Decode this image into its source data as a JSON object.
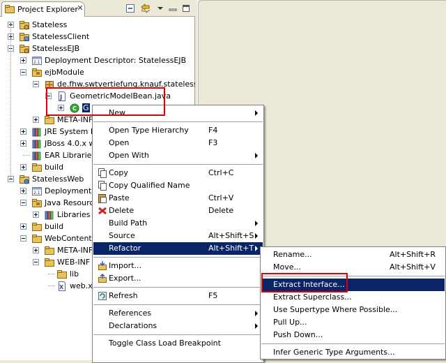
{
  "view": {
    "title": "Project Explorer",
    "close_glyph": "✕"
  },
  "tree": [
    {
      "label": "Stateless",
      "icon": "ejb-project-icon",
      "level": 0,
      "expander": "plus"
    },
    {
      "label": "StatelessClient",
      "icon": "client-project-icon",
      "level": 0,
      "expander": "plus"
    },
    {
      "label": "StatelessEJB",
      "icon": "ejb-project-icon",
      "level": 0,
      "expander": "minus"
    },
    {
      "label": "Deployment Descriptor: StatelessEJB",
      "icon": "deployment-descriptor-icon",
      "level": 1,
      "expander": "plus"
    },
    {
      "label": "ejbModule",
      "icon": "source-folder-icon",
      "level": 1,
      "expander": "minus"
    },
    {
      "label": "de.fhw.swtvertiefung.knauf.stateless",
      "icon": "package-icon",
      "level": 2,
      "expander": "minus"
    },
    {
      "label": "GeometricModelBean.java",
      "icon": "java-file-icon",
      "level": 3,
      "expander": "minus"
    },
    {
      "label": "G",
      "icon": "class-icon",
      "level": 4,
      "expander": "plus",
      "selected": true
    },
    {
      "label": "META-INF",
      "icon": "folder-icon",
      "level": 2,
      "expander": "plus"
    },
    {
      "label": "JRE System Li",
      "icon": "library-icon",
      "level": 1,
      "expander": "plus"
    },
    {
      "label": "JBoss 4.0.x w",
      "icon": "library-icon",
      "level": 1,
      "expander": "plus"
    },
    {
      "label": "EAR Libraries",
      "icon": "library-icon",
      "level": 1,
      "expander": "none"
    },
    {
      "label": "build",
      "icon": "folder-icon",
      "level": 1,
      "expander": "plus"
    },
    {
      "label": "StatelessWeb",
      "icon": "web-project-icon",
      "level": 0,
      "expander": "minus"
    },
    {
      "label": "Deployment D",
      "icon": "deployment-descriptor-icon",
      "level": 1,
      "expander": "plus"
    },
    {
      "label": "Java Resourc",
      "icon": "source-folder-icon",
      "level": 1,
      "expander": "minus"
    },
    {
      "label": "Libraries",
      "icon": "library-icon",
      "level": 2,
      "expander": "plus"
    },
    {
      "label": "build",
      "icon": "folder-icon",
      "level": 1,
      "expander": "plus"
    },
    {
      "label": "WebContent",
      "icon": "folder-icon",
      "level": 1,
      "expander": "minus"
    },
    {
      "label": "META-INF",
      "icon": "folder-icon",
      "level": 2,
      "expander": "plus"
    },
    {
      "label": "WEB-INF",
      "icon": "folder-icon",
      "level": 2,
      "expander": "minus"
    },
    {
      "label": "lib",
      "icon": "folder-icon",
      "level": 3,
      "expander": "none"
    },
    {
      "label": "web.x",
      "icon": "xml-file-icon",
      "level": 3,
      "expander": "none"
    }
  ],
  "context_menu": {
    "items": [
      {
        "label": "New",
        "submenu": true
      },
      {
        "sep": true
      },
      {
        "label": "Open Type Hierarchy",
        "accel": "F4"
      },
      {
        "label": "Open",
        "accel": "F3"
      },
      {
        "label": "Open With",
        "submenu": true
      },
      {
        "sep": true
      },
      {
        "label": "Copy",
        "accel": "Ctrl+C",
        "icon": "copy-icon"
      },
      {
        "label": "Copy Qualified Name",
        "icon": "copy-icon"
      },
      {
        "label": "Paste",
        "accel": "Ctrl+V",
        "icon": "paste-icon"
      },
      {
        "label": "Delete",
        "accel": "Delete",
        "icon": "delete-icon"
      },
      {
        "label": "Build Path",
        "submenu": true
      },
      {
        "label": "Source",
        "accel": "Alt+Shift+S",
        "submenu": true
      },
      {
        "label": "Refactor",
        "accel": "Alt+Shift+T",
        "submenu": true,
        "highlighted": true
      },
      {
        "sep": true
      },
      {
        "label": "Import...",
        "icon": "import-icon"
      },
      {
        "label": "Export...",
        "icon": "export-icon"
      },
      {
        "sep": true
      },
      {
        "label": "Refresh",
        "accel": "F5",
        "icon": "refresh-icon"
      },
      {
        "sep": true
      },
      {
        "label": "References",
        "submenu": true
      },
      {
        "label": "Declarations",
        "submenu": true
      },
      {
        "sep": true
      },
      {
        "label": "Toggle Class Load Breakpoint"
      }
    ]
  },
  "refactor_menu": {
    "items": [
      {
        "label": "Rename...",
        "accel": "Alt+Shift+R"
      },
      {
        "label": "Move...",
        "accel": "Alt+Shift+V"
      },
      {
        "sep": true
      },
      {
        "label": "Extract Interface...",
        "highlighted": true
      },
      {
        "label": "Extract Superclass..."
      },
      {
        "label": "Use Supertype Where Possible..."
      },
      {
        "label": "Pull Up..."
      },
      {
        "label": "Push Down..."
      },
      {
        "sep": true
      },
      {
        "label": "Infer Generic Type Arguments..."
      }
    ]
  },
  "colors": {
    "selection": "#0a246a",
    "annotation": "#e00000",
    "folder": "#e8c25a"
  }
}
